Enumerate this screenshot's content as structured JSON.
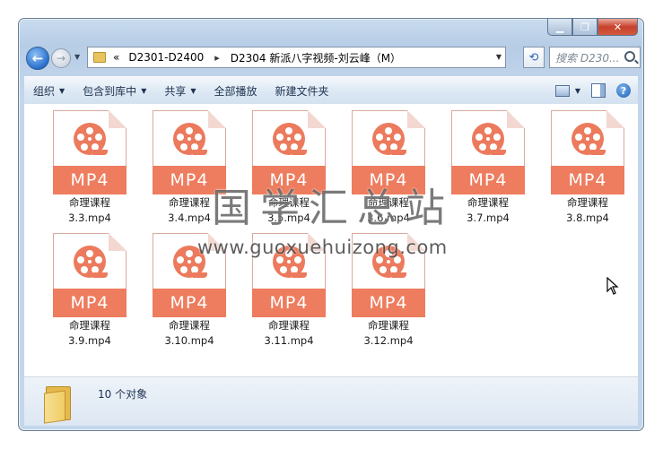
{
  "window": {
    "caption_buttons": {
      "min": "▁",
      "max": "❐",
      "close": "✕"
    }
  },
  "address_bar": {
    "overflow": "«",
    "crumbs": [
      "D2301-D2400",
      "D2304 新派八字视频-刘云峰（M）"
    ],
    "separator": "▸",
    "search_placeholder": "搜索 D230..."
  },
  "toolbar": {
    "organize": "组织",
    "include_in_library": "包含到库中",
    "share": "共享",
    "play_all": "全部播放",
    "new_folder": "新建文件夹"
  },
  "files": [
    {
      "name": "命理课程3.3.mp4",
      "line1": "命理课程",
      "line2": "3.3.mp4",
      "badge": "MP4"
    },
    {
      "name": "命理课程3.4.mp4",
      "line1": "命理课程",
      "line2": "3.4.mp4",
      "badge": "MP4"
    },
    {
      "name": "命理课程3.5.mp4",
      "line1": "命理课程",
      "line2": "3.5.mp4",
      "badge": "MP4"
    },
    {
      "name": "命理课程3.6.mp4",
      "line1": "命理课程",
      "line2": "3.6.mp4",
      "badge": "MP4"
    },
    {
      "name": "命理课程3.7.mp4",
      "line1": "命理课程",
      "line2": "3.7.mp4",
      "badge": "MP4"
    },
    {
      "name": "命理课程3.8.mp4",
      "line1": "命理课程",
      "line2": "3.8.mp4",
      "badge": "MP4"
    },
    {
      "name": "命理课程3.9.mp4",
      "line1": "命理课程",
      "line2": "3.9.mp4",
      "badge": "MP4"
    },
    {
      "name": "命理课程3.10.mp4",
      "line1": "命理课程",
      "line2": "3.10.mp4",
      "badge": "MP4"
    },
    {
      "name": "命理课程3.11.mp4",
      "line1": "命理课程",
      "line2": "3.11.mp4",
      "badge": "MP4"
    },
    {
      "name": "命理课程3.12.mp4",
      "line1": "命理课程",
      "line2": "3.12.mp4",
      "badge": "MP4"
    }
  ],
  "watermark": {
    "title": "国学汇总站",
    "url": "www.guoxuehuizong.com"
  },
  "status_bar": {
    "count": "10 个对象"
  },
  "colors": {
    "mp4_accent": "#ee7c5e"
  }
}
